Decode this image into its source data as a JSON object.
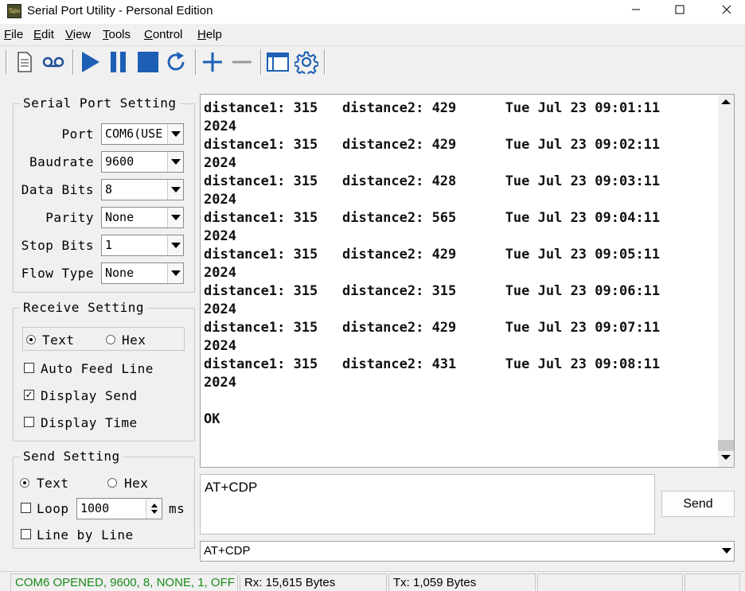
{
  "window": {
    "title": "Serial Port Utility - Personal Edition",
    "icon_text": "Spu"
  },
  "menu": [
    {
      "key": "F",
      "rest": "ile"
    },
    {
      "key": "E",
      "rest": "dit"
    },
    {
      "key": "V",
      "rest": "iew"
    },
    {
      "key": "T",
      "rest": "ools"
    },
    {
      "key": "C",
      "rest": "ontrol"
    },
    {
      "key": "H",
      "rest": "elp"
    }
  ],
  "toolbar_icons": [
    "new-file-icon",
    "record-icon",
    "play-icon",
    "pause-icon",
    "stop-icon",
    "refresh-icon",
    "plus-icon",
    "minus-icon",
    "window-icon",
    "gear-icon"
  ],
  "serial_setting": {
    "title": "Serial Port Setting",
    "port_label": "Port",
    "port_value": "COM6(USE",
    "baud_label": "Baudrate",
    "baud_value": "9600",
    "databits_label": "Data Bits",
    "databits_value": "8",
    "parity_label": "Parity",
    "parity_value": "None",
    "stopbits_label": "Stop Bits",
    "stopbits_value": "1",
    "flow_label": "Flow Type",
    "flow_value": "None"
  },
  "receive_setting": {
    "title": "Receive Setting",
    "text_label": "Text",
    "hex_label": "Hex",
    "mode": "Text",
    "auto_feed_label": "Auto Feed Line",
    "auto_feed": false,
    "display_send_label": "Display Send",
    "display_send": true,
    "display_time_label": "Display Time",
    "display_time": false
  },
  "send_setting": {
    "title": "Send Setting",
    "text_label": "Text",
    "hex_label": "Hex",
    "mode": "Text",
    "loop_label": "Loop",
    "loop": false,
    "loop_value": "1000",
    "loop_unit": "ms",
    "line_by_line_label": "Line by Line",
    "line_by_line": false
  },
  "receive_log": "distance1: 315   distance2: 429      Tue Jul 23 09:01:11\n2024\ndistance1: 315   distance2: 429      Tue Jul 23 09:02:11\n2024\ndistance1: 315   distance2: 428      Tue Jul 23 09:03:11\n2024\ndistance1: 315   distance2: 565      Tue Jul 23 09:04:11\n2024\ndistance1: 315   distance2: 429      Tue Jul 23 09:05:11\n2024\ndistance1: 315   distance2: 315      Tue Jul 23 09:06:11\n2024\ndistance1: 315   distance2: 429      Tue Jul 23 09:07:11\n2024\ndistance1: 315   distance2: 431      Tue Jul 23 09:08:11\n2024\n\nOK",
  "send_text": "AT+CDP",
  "send_button": "Send",
  "history_value": "AT+CDP",
  "status": {
    "port_status": "COM6 OPENED, 9600, 8, NONE, 1, OFF",
    "rx": "Rx: 15,615 Bytes",
    "tx": "Tx: 1,059 Bytes",
    "status_color": "#1a8a1a"
  }
}
